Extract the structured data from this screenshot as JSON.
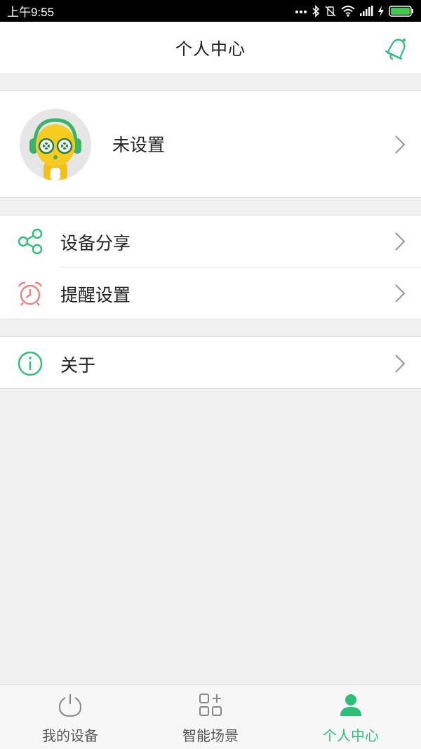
{
  "status_bar": {
    "time": "上午9:55",
    "icons": [
      "dots-icon",
      "bluetooth-icon",
      "vibrate-off-icon",
      "wifi-icon",
      "signal-icon",
      "charging-icon",
      "battery-icon"
    ]
  },
  "header": {
    "title": "个人中心",
    "bell_icon": "bell-icon"
  },
  "profile": {
    "name": "未设置",
    "avatar_icon": "robot-avatar-icon"
  },
  "menu": [
    {
      "label": "设备分享",
      "icon": "share-icon"
    },
    {
      "label": "提醒设置",
      "icon": "alarm-clock-icon"
    },
    {
      "label": "关于",
      "icon": "info-icon"
    }
  ],
  "tabs": [
    {
      "label": "我的设备",
      "icon": "power-icon",
      "active": false
    },
    {
      "label": "智能场景",
      "icon": "scene-grid-icon",
      "active": false
    },
    {
      "label": "个人中心",
      "icon": "person-icon",
      "active": true
    }
  ],
  "colors": {
    "accent": "#2bbf78",
    "alarm": "#f08080",
    "background": "#f0f0f0"
  }
}
